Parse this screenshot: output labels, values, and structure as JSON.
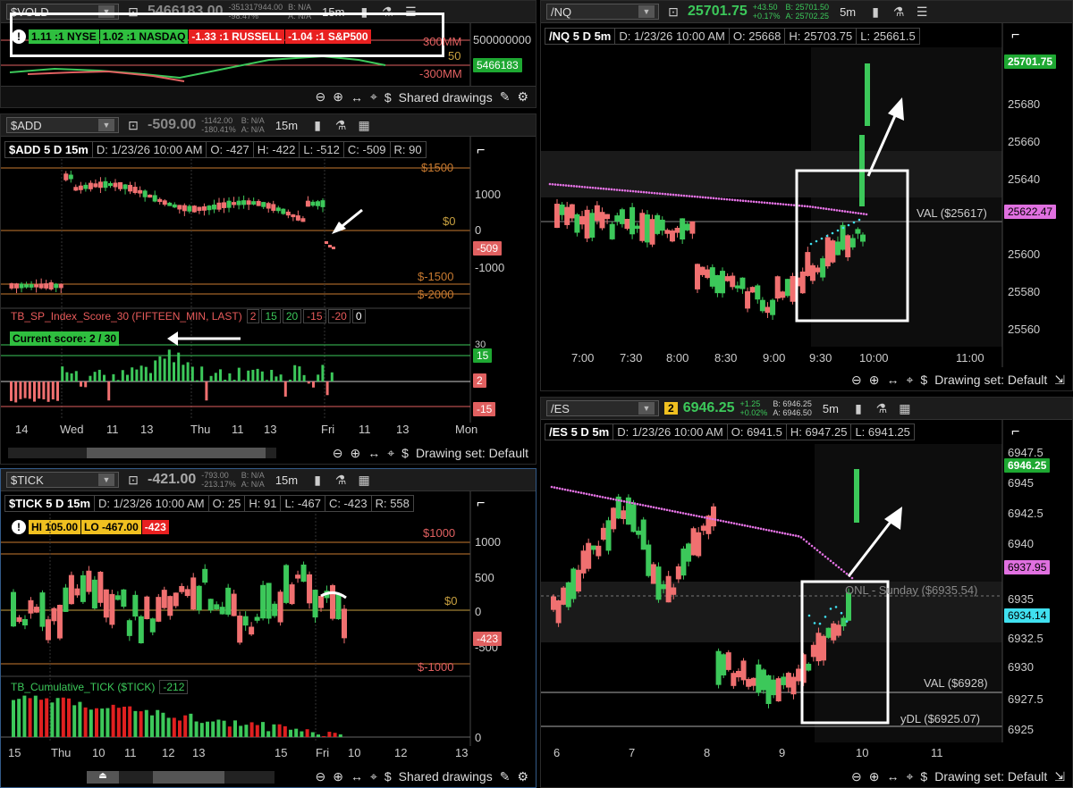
{
  "vold": {
    "symbol": "$VOLD",
    "price": "5466183.00",
    "chg1": "-351317944.00",
    "chg2": "-98.47%",
    "bid": "B: N/A",
    "ask": "A: N/A",
    "tf": "15m",
    "breadth": [
      "1.11 :1 NYSE",
      "1.02 :1 NASDAQ",
      "-1.33 :1 RUSSELL",
      "-1.04 :1 S&P500"
    ],
    "ax_top": "500000000",
    "lbl_300": "300MM",
    "lbl_m300": "-300MM",
    "lbl_50": "50",
    "last": "5466183",
    "footer": "Shared drawings"
  },
  "add": {
    "symbol": "$ADD",
    "price": "-509.00",
    "chg1": "-1142.00",
    "chg2": "-180.41%",
    "bid": "B: N/A",
    "ask": "A: N/A",
    "tf": "15m",
    "info": {
      "name": "$ADD 5 D 15m",
      "d": "D: 1/23/26 10:00 AM",
      "o": "O: -427",
      "h": "H: -422",
      "l": "L: -512",
      "c": "C: -509",
      "r": "R: 90"
    },
    "levels": [
      "$1500",
      "$0",
      "$-1500",
      "$-2000"
    ],
    "axis": [
      "1000",
      "0",
      "-1000"
    ],
    "last": "-509",
    "study": {
      "name": "TB_SP_Index_Score_30 (FIFTEEN_MIN, LAST)",
      "p1": "2",
      "p2": "15",
      "p3": "20",
      "p4": "-15",
      "p5": "-20",
      "p6": "0"
    },
    "score": "Current score: 2 / 30",
    "study_axis": [
      "30",
      "15",
      "2",
      "-15"
    ],
    "xlabels": [
      "14",
      "Wed",
      "11",
      "13",
      "Thu",
      "11",
      "13",
      "Fri",
      "11",
      "13",
      "Mon"
    ],
    "footer": "Drawing set: Default"
  },
  "tick": {
    "symbol": "$TICK",
    "price": "-421.00",
    "chg1": "-793.00",
    "chg2": "-213.17%",
    "bid": "B: N/A",
    "ask": "A: N/A",
    "tf": "15m",
    "info": {
      "name": "$TICK 5 D 15m",
      "d": "D: 1/23/26 10:00 AM",
      "o": "O: 25",
      "h": "H: 91",
      "l": "L: -467",
      "c": "C: -423",
      "r": "R: 558"
    },
    "hi": "HI 105.00",
    "lo": "LO -467.00",
    "cur": "-423",
    "levels": [
      "$1000",
      "$0",
      "$-1000"
    ],
    "axis": [
      "1000",
      "500",
      "0",
      "-500"
    ],
    "study": {
      "name": "TB_Cumulative_TICK ($TICK)",
      "val": "-212"
    },
    "study_axis": [
      "0"
    ],
    "xlabels": [
      "15",
      "Thu",
      "10",
      "11",
      "12",
      "13",
      "15",
      "Fri",
      "10",
      "12",
      "13"
    ],
    "footer": "Shared drawings"
  },
  "nq": {
    "symbol": "/NQ",
    "price": "25701.75",
    "chg1": "+43.50",
    "chg2": "+0.17%",
    "bid": "B: 25701.50",
    "ask": "A: 25702.25",
    "tf": "5m",
    "info": {
      "name": "/NQ 5 D 5m",
      "d": "D: 1/23/26 10:00 AM",
      "o": "O: 25668",
      "h": "H: 25703.75",
      "l": "L: 25661.5"
    },
    "axis": [
      "25680",
      "25660",
      "25640",
      "25600",
      "25580",
      "25560"
    ],
    "last": "25701.75",
    "val_label": "VAL ($25617)",
    "val_price": "25622.47",
    "xlabels": [
      "7:00",
      "7:30",
      "8:00",
      "8:30",
      "9:00",
      "9:30",
      "10:00",
      "11:00"
    ],
    "footer": "Drawing set: Default"
  },
  "es": {
    "symbol": "/ES",
    "link": "2",
    "price": "6946.25",
    "chg1": "+1.25",
    "chg2": "+0.02%",
    "bid": "B: 6946.25",
    "ask": "A: 6946.50",
    "tf": "5m",
    "info": {
      "name": "/ES 5 D 5m",
      "d": "D: 1/23/26 10:00 AM",
      "o": "O: 6941.5",
      "h": "H: 6947.25",
      "l": "L: 6941.25"
    },
    "axis": [
      "6947.5",
      "6945",
      "6942.5",
      "6940",
      "6935",
      "6932.5",
      "6930",
      "6927.5",
      "6925"
    ],
    "last": "6946.25",
    "vwap": "6937.95",
    "cyan": "6934.14",
    "onl": "ONL - Sunday ($6935.54)",
    "val_label": "VAL ($6928)",
    "ylow": "yDL ($6925.07)",
    "xlabels": [
      "6",
      "7",
      "8",
      "9",
      "10",
      "11"
    ],
    "footer": "Drawing set: Default"
  }
}
